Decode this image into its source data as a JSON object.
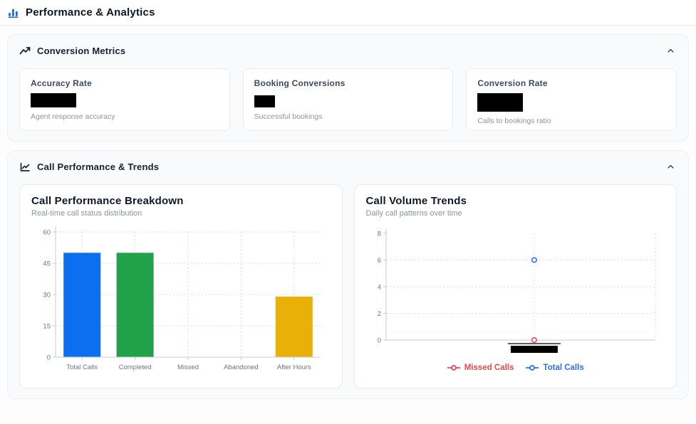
{
  "page": {
    "title": "Performance & Analytics"
  },
  "sections": {
    "conversion": {
      "title": "Conversion Metrics",
      "cards": [
        {
          "title": "Accuracy Rate",
          "subtitle": "Agent response accuracy",
          "value_redacted": true
        },
        {
          "title": "Booking Conversions",
          "subtitle": "Successful bookings",
          "value_redacted": true
        },
        {
          "title": "Conversion Rate",
          "subtitle": "Calls to bookings ratio",
          "value_redacted": true
        }
      ]
    },
    "performance": {
      "title": "Call Performance & Trends"
    }
  },
  "colors": {
    "accent_blue": "#2563eb",
    "bar_blue": "#0b6ff0",
    "bar_green": "#22a14b",
    "bar_yellow": "#e9b007",
    "series_red": "#e8494d",
    "series_blue": "#2e6ef5"
  },
  "chart_data": [
    {
      "type": "bar",
      "title": "Call Performance Breakdown",
      "subtitle": "Real-time call status distribution",
      "categories": [
        "Total Calls",
        "Completed",
        "Missed",
        "Abandoned",
        "After Hours"
      ],
      "values": [
        50,
        50,
        0,
        0,
        29
      ],
      "bar_colors": [
        "#0b6ff0",
        "#22a14b",
        "#0b6ff0",
        "#0b6ff0",
        "#e9b007"
      ],
      "xlabel": "",
      "ylabel": "",
      "ylim": [
        0,
        60
      ],
      "yticks": [
        0,
        15,
        30,
        45,
        60
      ],
      "grid": "dotted",
      "legend_position": "none"
    },
    {
      "type": "scatter",
      "title": "Call Volume Trends",
      "subtitle": "Daily call patterns over time",
      "x": [
        "[redacted]"
      ],
      "x_label_redacted": true,
      "series": [
        {
          "name": "Missed Calls",
          "color": "#e8494d",
          "values": [
            0
          ]
        },
        {
          "name": "Total Calls",
          "color": "#2e6ef5",
          "values": [
            6
          ]
        }
      ],
      "xlabel": "",
      "ylabel": "",
      "ylim": [
        0,
        8
      ],
      "yticks": [
        0,
        2,
        4,
        6,
        8
      ],
      "grid": "dotted",
      "legend_position": "bottom"
    }
  ]
}
